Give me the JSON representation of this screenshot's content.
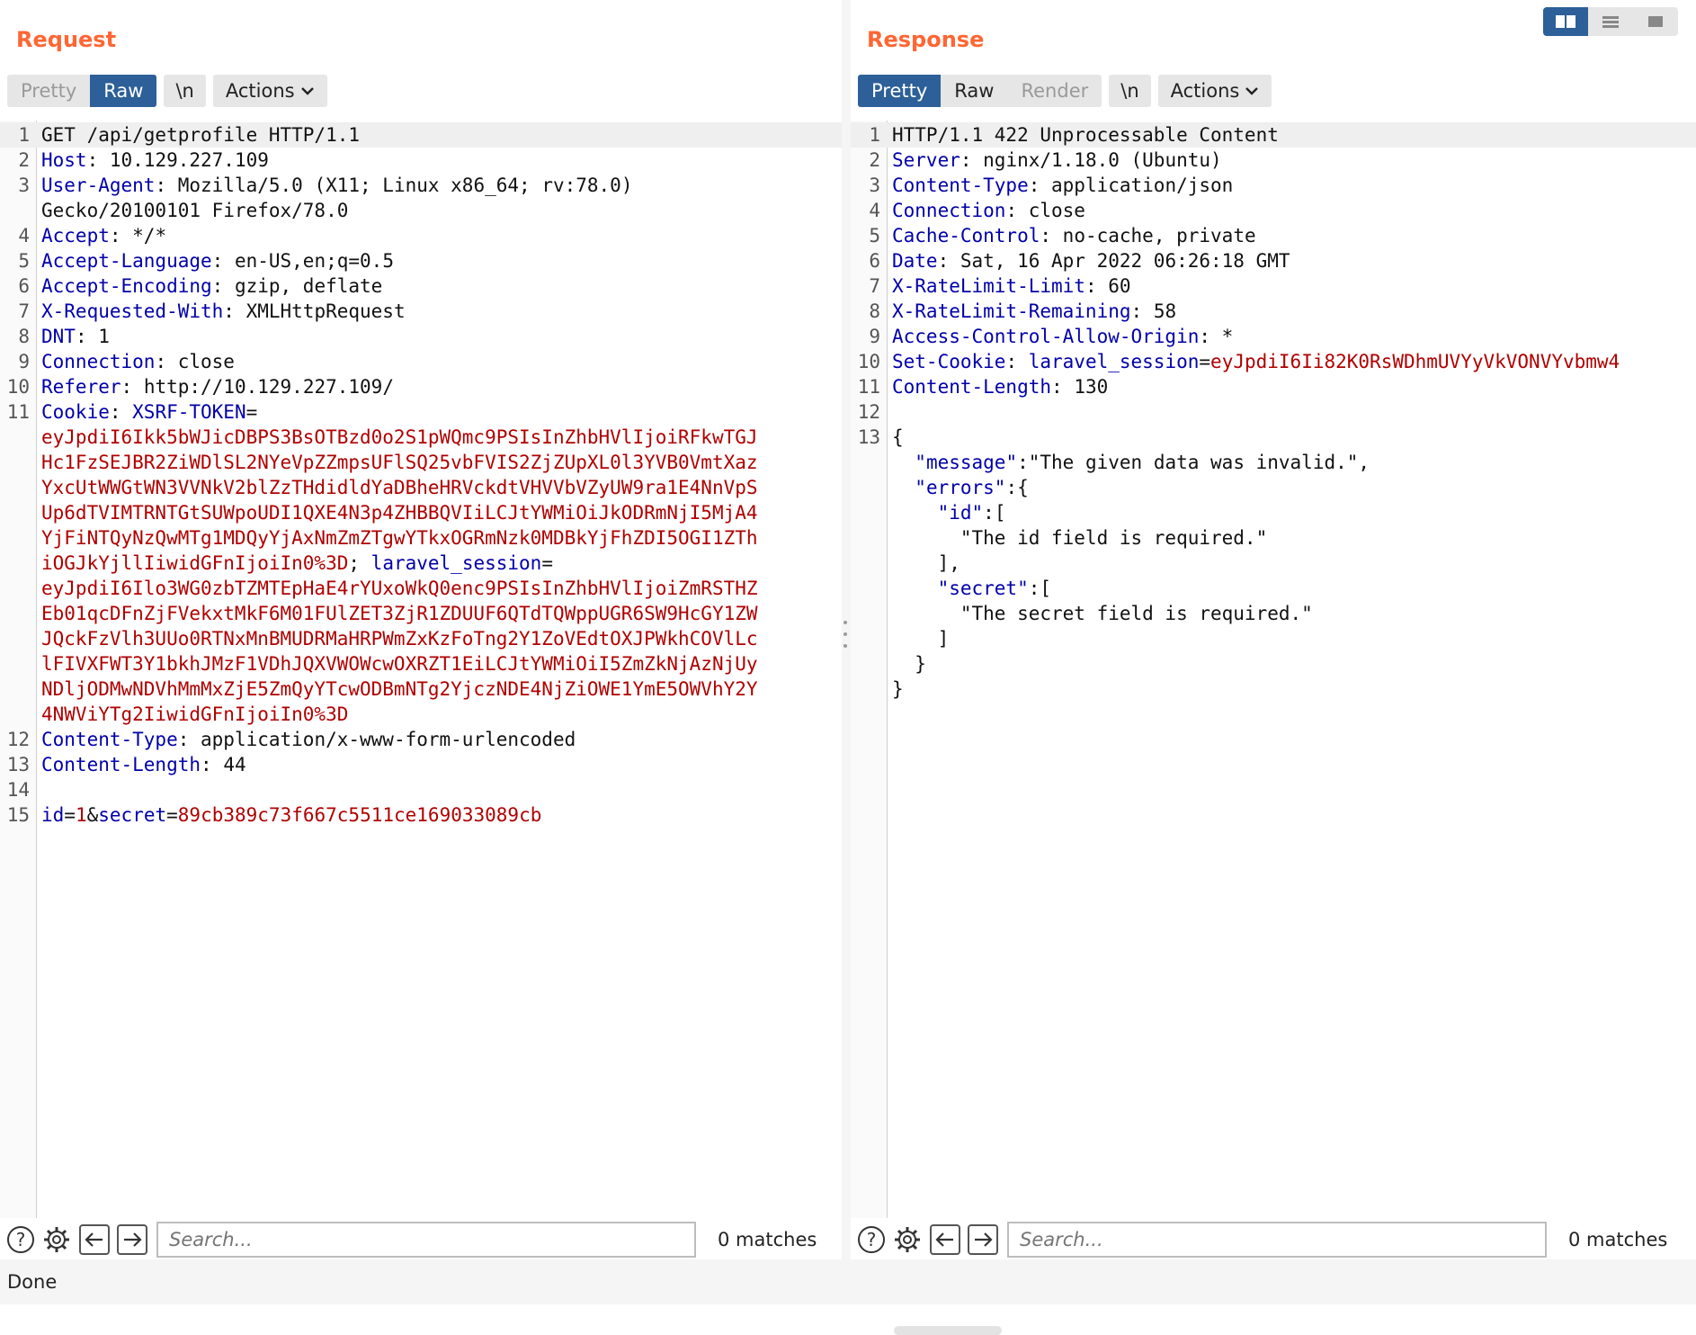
{
  "request": {
    "title": "Request",
    "tabs": {
      "pretty": "Pretty",
      "raw": "Raw",
      "newline": "\\n",
      "actions": "Actions"
    },
    "lines": [
      {
        "n": "1",
        "text": "GET /api/getprofile HTTP/1.1"
      },
      {
        "n": "2",
        "key": "Host",
        "value": "10.129.227.109"
      },
      {
        "n": "3",
        "key": "User-Agent",
        "value": "Mozilla/5.0 (X11; Linux x86_64; rv:78.0)",
        "cont": "Gecko/20100101 Firefox/78.0"
      },
      {
        "n": "4",
        "key": "Accept",
        "value": "*/*"
      },
      {
        "n": "5",
        "key": "Accept-Language",
        "value": "en-US,en;q=0.5"
      },
      {
        "n": "6",
        "key": "Accept-Encoding",
        "value": "gzip, deflate"
      },
      {
        "n": "7",
        "key": "X-Requested-With",
        "value": "XMLHttpRequest"
      },
      {
        "n": "8",
        "key": "DNT",
        "value": "1"
      },
      {
        "n": "9",
        "key": "Connection",
        "value": "close"
      },
      {
        "n": "10",
        "key": "Referer",
        "value": "http://10.129.227.109/"
      },
      {
        "n": "11",
        "key": "Cookie",
        "cookie_name1": "XSRF-TOKEN",
        "eq": "=",
        "xsrf_lines": [
          "eyJpdiI6Ikk5bWJicDBPS3BsOTBzd0o2S1pWQmc9PSIsInZhbHVlIjoiRFkwTGJ",
          "Hc1FzSEJBR2ZiWDlSL2NYeVpZZmpsUFlSQ25vbFVIS2ZjZUpXL0l3YVB0VmtXaz",
          "YxcUtWWGtWN3VVNkV2blZzTHdidldYaDBheHRVckdtVHVVbVZyUW9ra1E4NnVpS",
          "Up6dTVIMTRNTGtSUWpoUDI1QXE4N3p4ZHBBQVIiLCJtYWMiOiJkODRmNjI5MjA4",
          "YjFiNTQyNzQwMTg1MDQyYjAxNmZmZTgwYTkxOGRmNzk0MDBkYjFhZDI5OGI1ZTh",
          "iOGJkYjllIiwidGFnIjoiIn0%3D"
        ],
        "sep": "; ",
        "cookie_name2": "laravel_session",
        "session_lines": [
          "eyJpdiI6Ilo3WG0zbTZMTEpHaE4rYUxoWkQ0enc9PSIsInZhbHVlIjoiZmRSTHZ",
          "Eb01qcDFnZjFVekxtMkF6M01FUlZET3ZjR1ZDUUF6QTdTQWppUGR6SW9HcGY1ZW",
          "JQckFzVlh3UUo0RTNxMnBMUDRMaHRPWmZxKzFoTng2Y1ZoVEdtOXJPWkhCOVlLc",
          "lFIVXFWT3Y1bkhJMzF1VDhJQXVWOWcwOXRZT1EiLCJtYWMiOiI5ZmZkNjAzNjUy",
          "NDljODMwNDVhMmMxZjE5ZmQyYTcwODBmNTg2YjczNDE4NjZiOWE1YmE5OWVhY2Y",
          "4NWViYTg2IiwidGFnIjoiIn0%3D"
        ]
      },
      {
        "n": "12",
        "key": "Content-Type",
        "value": "application/x-www-form-urlencoded"
      },
      {
        "n": "13",
        "key": "Content-Length",
        "value": "44"
      },
      {
        "n": "14"
      },
      {
        "n": "15",
        "p1": "id",
        "v1": "1",
        "amp": "&",
        "p2": "secret",
        "v2": "89cb389c73f667c5511ce169033089cb"
      }
    ],
    "footer": {
      "search_placeholder": "Search...",
      "matches": "0 matches"
    }
  },
  "response": {
    "title": "Response",
    "tabs": {
      "pretty": "Pretty",
      "raw": "Raw",
      "render": "Render",
      "newline": "\\n",
      "actions": "Actions"
    },
    "lines": [
      {
        "n": "1",
        "text": "HTTP/1.1 422 Unprocessable Content"
      },
      {
        "n": "2",
        "key": "Server",
        "value": "nginx/1.18.0 (Ubuntu)"
      },
      {
        "n": "3",
        "key": "Content-Type",
        "value": "application/json"
      },
      {
        "n": "4",
        "key": "Connection",
        "value": "close"
      },
      {
        "n": "5",
        "key": "Cache-Control",
        "value": "no-cache, private"
      },
      {
        "n": "6",
        "key": "Date",
        "value": "Sat, 16 Apr 2022 06:26:18 GMT"
      },
      {
        "n": "7",
        "key": "X-RateLimit-Limit",
        "value": "60"
      },
      {
        "n": "8",
        "key": "X-RateLimit-Remaining",
        "value": "58"
      },
      {
        "n": "9",
        "key": "Access-Control-Allow-Origin",
        "value": "*"
      },
      {
        "n": "10",
        "key": "Set-Cookie",
        "cname": "laravel_session",
        "eq": "=",
        "cval": "eyJpdiI6Ii82K0RsWDhmUVYyVkVONVYvbmw4"
      },
      {
        "n": "11",
        "key": "Content-Length",
        "value": "130"
      },
      {
        "n": "12"
      },
      {
        "n": "13",
        "text": "{"
      }
    ],
    "json": {
      "message_key": "\"message\"",
      "colon": ":",
      "message_value": "\"The given data was invalid.\",",
      "errors_key": "\"errors\"",
      "open_obj": "{",
      "id_key": "\"id\"",
      "open_arr": "[",
      "id_msg": "\"The id field is required.\"",
      "close_arr_comma": "],",
      "secret_key": "\"secret\"",
      "secret_msg": "\"The secret field is required.\"",
      "close_arr": "]",
      "close_obj": "}"
    },
    "footer": {
      "search_placeholder": "Search...",
      "matches": "0 matches"
    }
  },
  "status": "Done",
  "colors": {
    "accent": "#ff6633",
    "active_tab": "#2d5f98",
    "header_key": "#0000aa",
    "value_red": "#b00000"
  }
}
